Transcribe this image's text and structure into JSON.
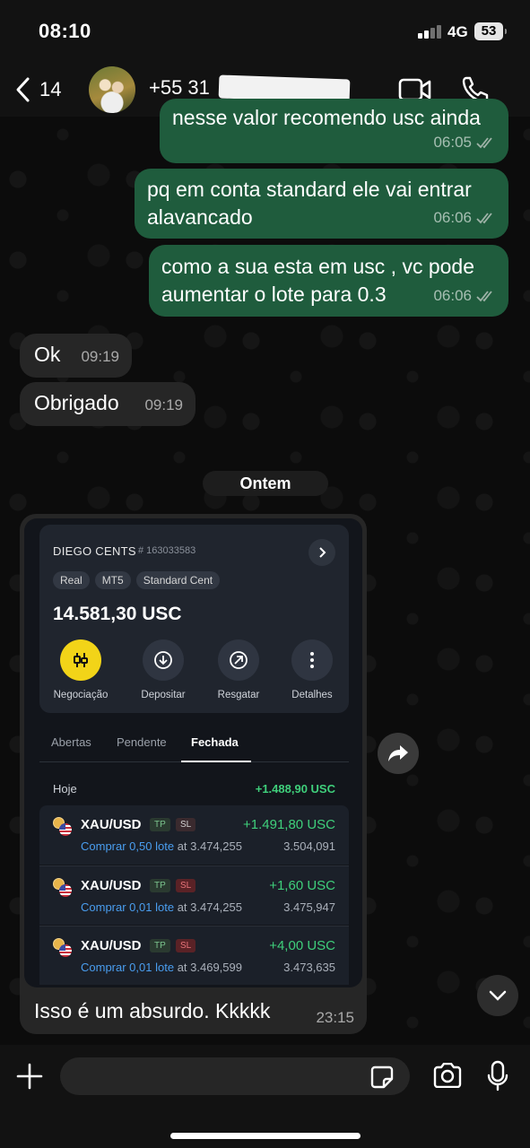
{
  "status_bar": {
    "time": "08:10",
    "network": "4G",
    "battery": "53"
  },
  "header": {
    "back_count": "14",
    "contact_name": "+55 31"
  },
  "messages": [
    {
      "dir": "out",
      "text": "nesse valor recomendo usc ainda",
      "time": "06:05"
    },
    {
      "dir": "out",
      "text": "pq em conta standard ele vai entrar alavancado",
      "time": "06:06"
    },
    {
      "dir": "out",
      "text": "como a sua esta em usc , vc pode aumentar o lote para 0.3",
      "time": "06:06"
    },
    {
      "dir": "in",
      "text": "Ok",
      "time": "09:19"
    },
    {
      "dir": "in",
      "text": "Obrigado",
      "time": "09:19"
    }
  ],
  "date_separator": "Ontem",
  "image_message": {
    "caption": "Isso é um absurdo. Kkkkk",
    "time": "23:15",
    "screenshot": {
      "account_name": "DIEGO CENTS",
      "account_number": "# 163033583",
      "tags": [
        "Real",
        "MT5",
        "Standard Cent"
      ],
      "balance": "14.581,30 USC",
      "actions": [
        "Negociação",
        "Depositar",
        "Resgatar",
        "Detalhes"
      ],
      "tabs": [
        "Abertas",
        "Pendente",
        "Fechada"
      ],
      "active_tab": "Fechada",
      "today_label": "Hoje",
      "today_total": "+1.488,90 USC",
      "trades": [
        {
          "symbol": "XAU/USD",
          "tp": "TP",
          "sl": "SL",
          "sl_red": false,
          "profit": "+1.491,80 USC",
          "buy": "Comprar 0,50 lote",
          "at": "at 3.474,255",
          "close": "3.504,091"
        },
        {
          "symbol": "XAU/USD",
          "tp": "TP",
          "sl": "SL",
          "sl_red": true,
          "profit": "+1,60 USC",
          "buy": "Comprar 0,01 lote",
          "at": "at 3.474,255",
          "close": "3.475,947"
        },
        {
          "symbol": "XAU/USD",
          "tp": "TP",
          "sl": "SL",
          "sl_red": true,
          "profit": "+4,00 USC",
          "buy": "Comprar 0,01 lote",
          "at": "at 3.469,599",
          "close": "3.473,635"
        }
      ]
    }
  },
  "composer": {
    "placeholder": ""
  },
  "colors": {
    "outgoing_bubble": "#1f5c3d",
    "incoming_bubble": "#262626",
    "profit_green": "#3fcf7b",
    "accent_yellow": "#f2d418",
    "link_blue": "#4a9ef0"
  }
}
